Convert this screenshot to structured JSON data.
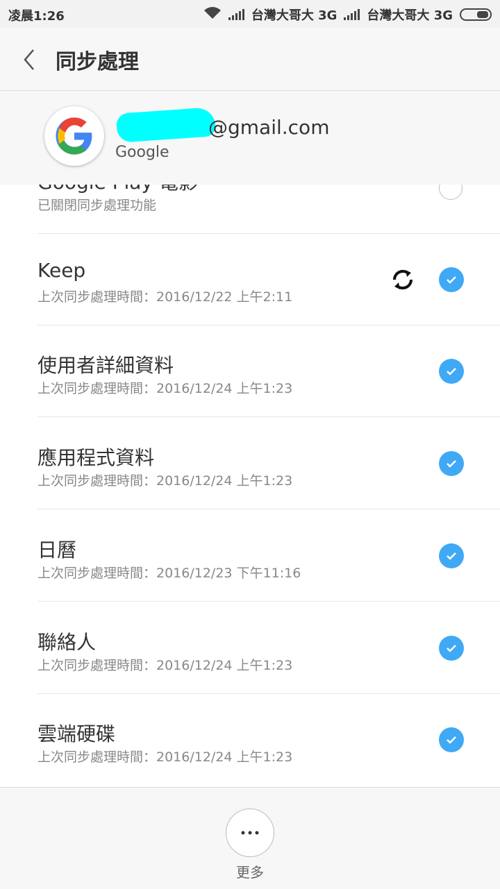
{
  "status_bar": {
    "time": "凌晨1:26",
    "carrier1": "台灣大哥大 3G",
    "carrier2": "台灣大哥大 3G"
  },
  "header": {
    "title": "同步處理"
  },
  "account": {
    "email_visible": "@gmail.com",
    "type": "Google"
  },
  "colors": {
    "accent": "#3fa9f5",
    "redaction": "#00ffff"
  },
  "sync_items": [
    {
      "name": "Google Play 電影",
      "status": "已關閉同步處理功能",
      "checked": false,
      "syncing": false
    },
    {
      "name": "Keep",
      "status": "上次同步處理時間：2016/12/22 上午2:11",
      "checked": true,
      "syncing": true
    },
    {
      "name": "使用者詳細資料",
      "status": "上次同步處理時間：2016/12/24 上午1:23",
      "checked": true,
      "syncing": false
    },
    {
      "name": "應用程式資料",
      "status": "上次同步處理時間：2016/12/24 上午1:23",
      "checked": true,
      "syncing": false
    },
    {
      "name": "日曆",
      "status": "上次同步處理時間：2016/12/23 下午11:16",
      "checked": true,
      "syncing": false
    },
    {
      "name": "聯絡人",
      "status": "上次同步處理時間：2016/12/24 上午1:23",
      "checked": true,
      "syncing": false
    },
    {
      "name": "雲端硬碟",
      "status": "上次同步處理時間：2016/12/24 上午1:23",
      "checked": true,
      "syncing": false
    }
  ],
  "bottom": {
    "more_label": "更多"
  }
}
